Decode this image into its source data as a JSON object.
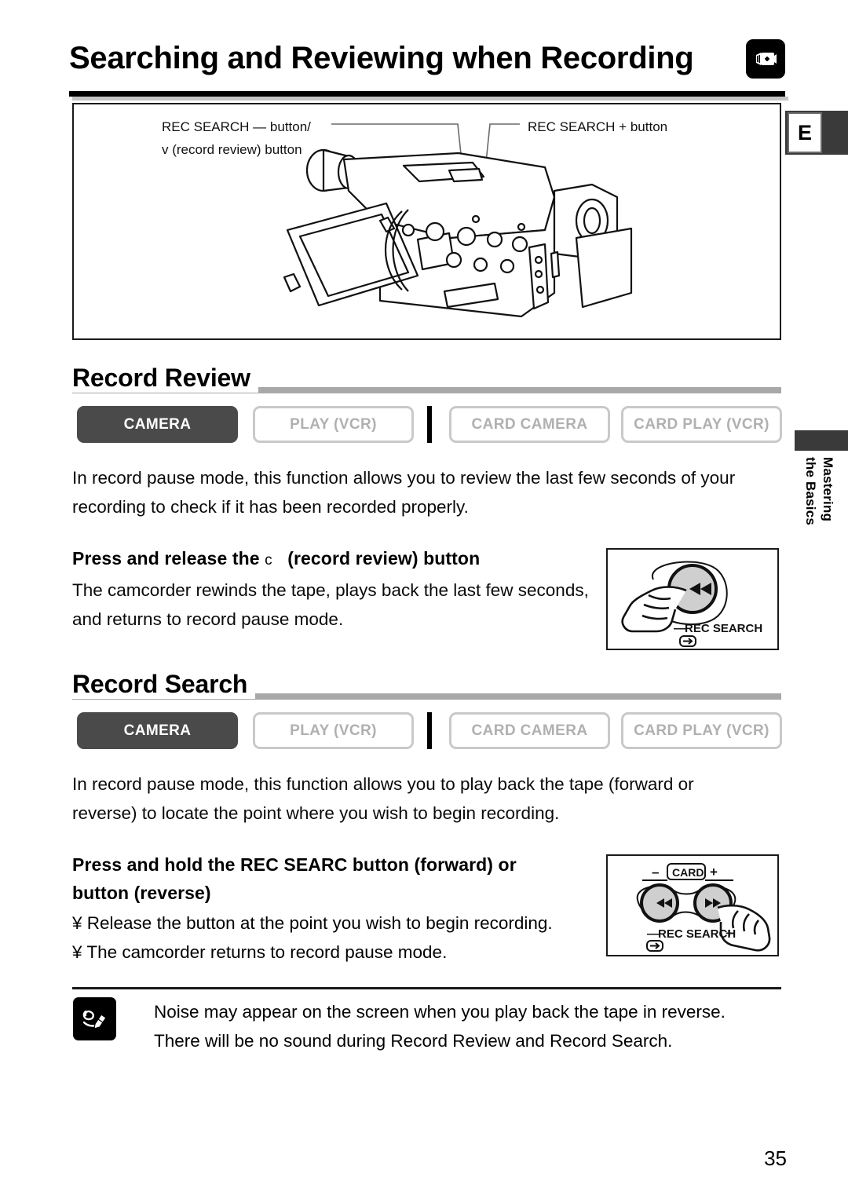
{
  "header": {
    "title": "Searching and Reviewing when Recording",
    "icon": "camcorder-icon"
  },
  "margin": {
    "edition_tab": "E",
    "side_tab_line1": "Mastering",
    "side_tab_line2": "the Basics"
  },
  "diagram": {
    "label_left_1": "REC SEARCH — button/",
    "label_left_2": "v   (record review) button",
    "label_right": "REC SEARCH + button",
    "illustration": "camcorder-rear-three-quarter-view"
  },
  "sections": [
    {
      "title": "Record Review",
      "modes": [
        {
          "label": "CAMERA",
          "state": "active"
        },
        {
          "label": "PLAY (VCR)",
          "state": "inactive"
        },
        {
          "label": "CARD CAMERA",
          "state": "inactive"
        },
        {
          "label": "CARD PLAY (VCR)",
          "state": "inactive"
        }
      ],
      "intro_line1": "In record pause mode, this function allows you to review the last few seconds of your",
      "intro_line2": "recording to check if it has been recorded properly.",
      "step_head_pre": "Press and release the",
      "step_head_sym": "c",
      "step_head_post": "(record review) button",
      "step_body_line1": "The camcorder rewinds the tape, plays back the last few seconds,",
      "step_body_line2": "and returns to record pause mode.",
      "panel": {
        "button_glyph": "◀◀",
        "caption_minus": "—",
        "caption_text": "REC SEARCH",
        "tape_icon": "tape-rewind-icon"
      }
    },
    {
      "title": "Record Search",
      "modes": [
        {
          "label": "CAMERA",
          "state": "active"
        },
        {
          "label": "PLAY (VCR)",
          "state": "inactive"
        },
        {
          "label": "CARD CAMERA",
          "state": "inactive"
        },
        {
          "label": "CARD PLAY (VCR)",
          "state": "inactive"
        }
      ],
      "intro_line1": "In record pause mode, this function allows you to play back the tape (forward or",
      "intro_line2": "reverse) to locate the point where you wish to begin recording.",
      "step_head_line1": "Press and hold the REC SEARC         button (forward) or",
      "step_head_line2": "button (reverse)",
      "bullet_1": "¥ Release the button at the point you wish to begin recording.",
      "bullet_2": "¥ The camcorder returns to record pause mode.",
      "panel": {
        "top_minus": "–",
        "top_card": "CARD",
        "top_plus": "+",
        "button_left_glyph": "◀◀",
        "button_right_glyph": "▶▶",
        "caption_minus": "—",
        "caption_text": "REC SEARCH",
        "caption_plus": "+",
        "tape_icon": "tape-rewind-icon"
      }
    }
  ],
  "note": {
    "icon": "pencil-note-icon",
    "line1": "Noise may appear on the screen when you play back the tape in reverse.",
    "line2": "There will be no sound during Record Review and Record Search."
  },
  "footer": {
    "page_number": "35"
  },
  "colors": {
    "active_mode_bg": "#4a4a4a",
    "inactive_border": "#c9c9c9",
    "inactive_text": "#b0b0b0",
    "section_rule": "#a8a8a8",
    "tab_dark": "#3a3a3a"
  }
}
